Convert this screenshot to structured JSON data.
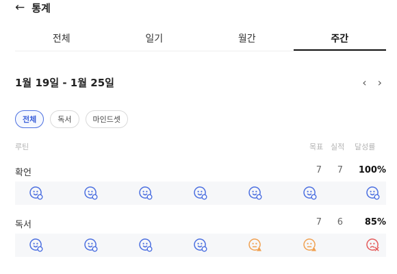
{
  "header": {
    "back_icon": "arrow-left-icon",
    "back_glyph": "←",
    "title": "통계"
  },
  "tabs": [
    {
      "label": "전체",
      "active": false
    },
    {
      "label": "일기",
      "active": false
    },
    {
      "label": "월간",
      "active": false
    },
    {
      "label": "주간",
      "active": true
    }
  ],
  "date_range": {
    "label": "1월 19일 - 1월 25일",
    "prev_glyph": "‹",
    "next_glyph": "›"
  },
  "filters": [
    {
      "label": "전체",
      "active": true
    },
    {
      "label": "독서",
      "active": false
    },
    {
      "label": "마인드셋",
      "active": false
    }
  ],
  "columns": {
    "routine": "루틴",
    "goal": "목표",
    "actual": "실적",
    "rate": "달성률"
  },
  "routines": [
    {
      "name": "확언",
      "goal": "7",
      "actual": "7",
      "rate": "100%",
      "days": [
        "done",
        "done",
        "done",
        "done",
        "done",
        "done",
        "done"
      ]
    },
    {
      "name": "독서",
      "goal": "7",
      "actual": "6",
      "rate": "85%",
      "days": [
        "done",
        "done",
        "done",
        "done",
        "partial",
        "partial",
        "missed"
      ]
    }
  ],
  "colors": {
    "done": "#4a6ee0",
    "partial": "#f0a050",
    "missed": "#e45a5a",
    "accent": "#3a5fd8"
  }
}
